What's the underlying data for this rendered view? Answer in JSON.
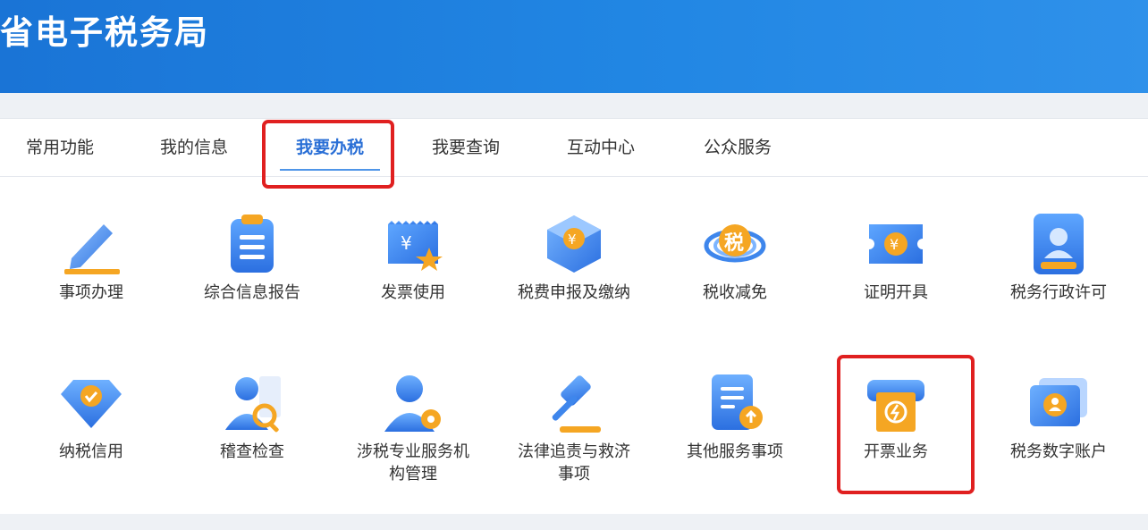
{
  "header": {
    "title": "省电子税务局"
  },
  "tabs": [
    {
      "label": "常用功能"
    },
    {
      "label": "我的信息"
    },
    {
      "label": "我要办税"
    },
    {
      "label": "我要查询"
    },
    {
      "label": "互动中心"
    },
    {
      "label": "公众服务"
    }
  ],
  "active_tab": "我要办税",
  "services": [
    {
      "label": "事项办理",
      "icon": "pen-icon"
    },
    {
      "label": "综合信息报告",
      "icon": "clipboard-icon"
    },
    {
      "label": "发票使用",
      "icon": "invoice-star-icon"
    },
    {
      "label": "税费申报及缴纳",
      "icon": "cube-yuan-icon"
    },
    {
      "label": "税收减免",
      "icon": "tax-emblem-icon"
    },
    {
      "label": "证明开具",
      "icon": "ticket-yuan-icon"
    },
    {
      "label": "税务行政许可",
      "icon": "license-stamp-icon"
    },
    {
      "label": "纳税信用",
      "icon": "diamond-check-icon"
    },
    {
      "label": "稽查检查",
      "icon": "inspector-icon"
    },
    {
      "label": "涉税专业服务机构管理",
      "icon": "agent-gear-icon"
    },
    {
      "label": "法律追责与救济事项",
      "icon": "gavel-icon"
    },
    {
      "label": "其他服务事项",
      "icon": "document-upload-icon"
    },
    {
      "label": "开票业务",
      "icon": "printer-bolt-icon"
    },
    {
      "label": "税务数字账户",
      "icon": "digital-account-icon"
    }
  ],
  "colors": {
    "brand": "#1a74d6",
    "active_tab": "#2a6fd6",
    "highlight": "#e02020",
    "icon_blue": "#3e86ec",
    "icon_orange": "#f5a623"
  }
}
